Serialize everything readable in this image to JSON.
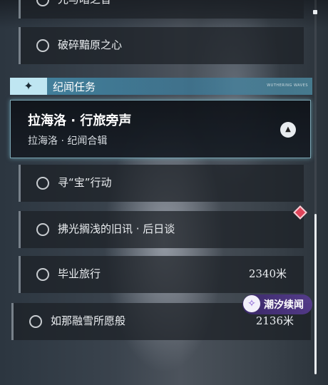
{
  "rows_top": [
    {
      "label": "光与暗之音"
    },
    {
      "label": "破碎黯原之心"
    }
  ],
  "section": {
    "title": "纪闻任务",
    "icon": "sparkle-icon",
    "ticker": "WUTHERING WAVES"
  },
  "featured": {
    "title": "拉海洛 · 行旅旁声",
    "subtitle": "拉海洛 · 纪闻合辑",
    "expand_icon": "chevron-up-icon"
  },
  "quests": [
    {
      "label": "寻“宝”行动",
      "distance": ""
    },
    {
      "label": "拂光搁浅的旧讯 · 后日谈",
      "distance": ""
    },
    {
      "label": "毕业旅行",
      "distance": "2340米"
    },
    {
      "label": "如那融雪所愿般",
      "distance": "2136米"
    }
  ],
  "badge": {
    "text": "潮汐续闻",
    "icon": "tide-icon"
  },
  "colors": {
    "accent": "#bfe6f2",
    "marker": "#e0445a",
    "badge": "#5a3c96"
  }
}
